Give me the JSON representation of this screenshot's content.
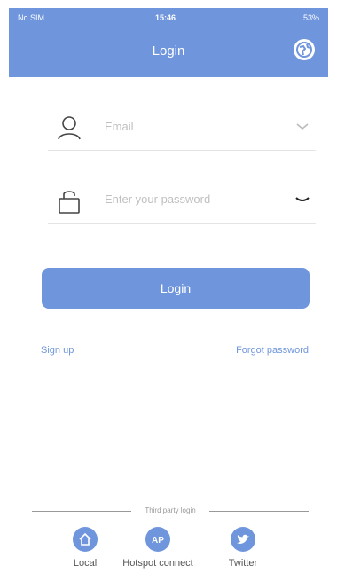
{
  "status_bar": {
    "carrier": "No SIM",
    "time": "15:46",
    "battery": "53%"
  },
  "header": {
    "title": "Login"
  },
  "form": {
    "email_placeholder": "Email",
    "password_placeholder": "Enter your password",
    "login_label": "Login"
  },
  "links": {
    "signup": "Sign up",
    "forgot": "Forgot password"
  },
  "third_party": {
    "label": "Third party login",
    "options": [
      {
        "label": "Local",
        "icon": "home-icon"
      },
      {
        "label": "Hotspot connect",
        "icon": "ap-icon",
        "icon_text": "AP"
      },
      {
        "label": "Twitter",
        "icon": "twitter-icon"
      }
    ]
  },
  "colors": {
    "accent": "#6f95dc",
    "placeholder": "#c0c0c0",
    "divider": "#e4e4e4"
  }
}
